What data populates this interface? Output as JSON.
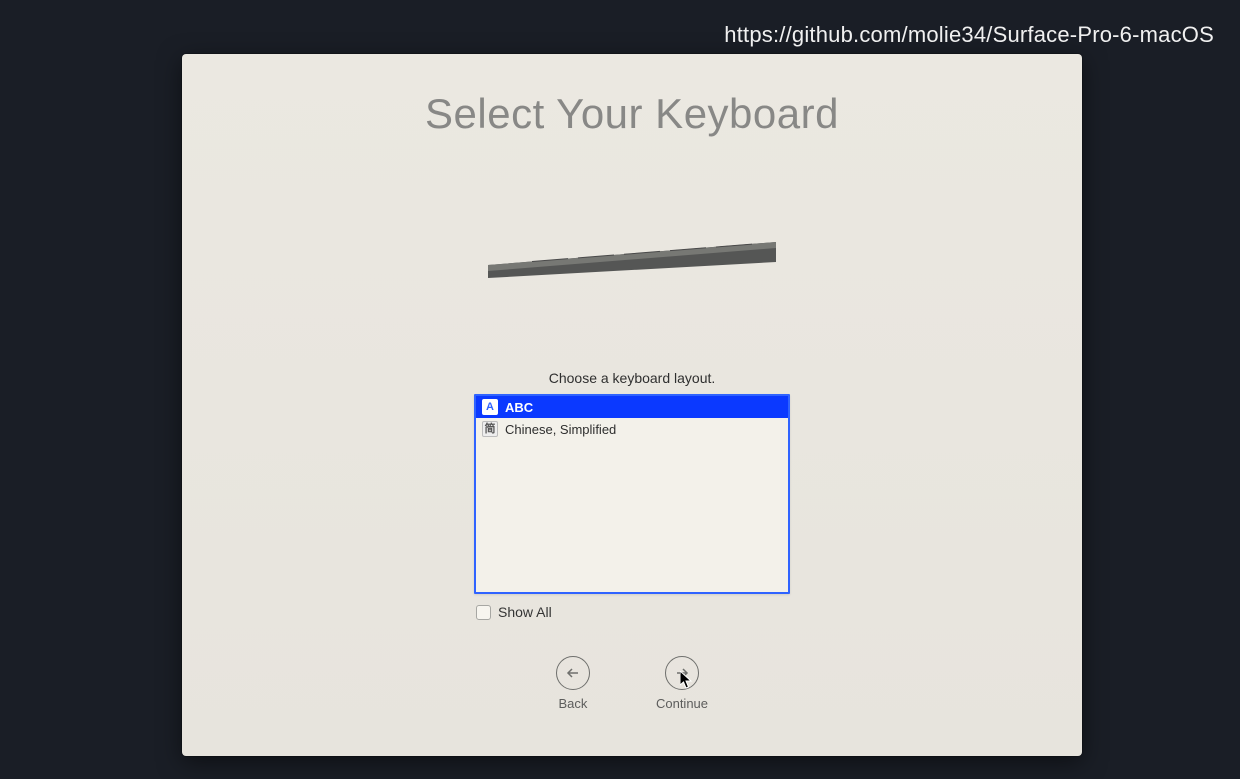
{
  "overlay_url": "https://github.com/molie34/Surface-Pro-6-macOS",
  "title": "Select Your Keyboard",
  "subheading": "Choose a keyboard layout.",
  "layouts": [
    {
      "icon_label": "A",
      "label": "ABC",
      "selected": true
    },
    {
      "icon_label": "简",
      "label": "Chinese, Simplified",
      "selected": false
    }
  ],
  "show_all": {
    "label": "Show All",
    "checked": false
  },
  "nav": {
    "back_label": "Back",
    "continue_label": "Continue"
  }
}
